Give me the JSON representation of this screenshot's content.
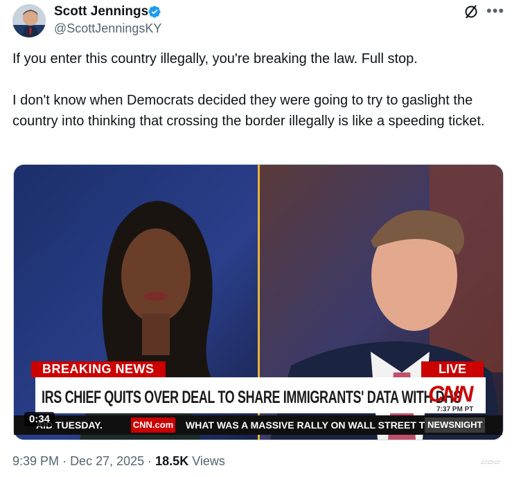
{
  "author": {
    "name": "Scott Jennings",
    "handle": "@ScottJenningsKY",
    "verified": true
  },
  "header_icons": {
    "grok": "grok-icon",
    "more": "more-icon"
  },
  "tweet": {
    "paragraphs": [
      "If you enter this country illegally, you're breaking the law. Full stop.",
      "I don't know when Democrats decided they were going to try to gaslight the country into thinking that crossing the border illegally is like a speeding ticket."
    ]
  },
  "video": {
    "duration": "0:34",
    "breaking_label": "BREAKING NEWS",
    "live_label": "LIVE",
    "headline": "IRS CHIEF QUITS OVER DEAL TO SHARE IMMIGRANTS' DATA WITH DHS",
    "network": "CNN",
    "time_stamp": "7:37 PM PT",
    "ticker_left": "AID TUESDAY.",
    "ticker_site": "CNN.com",
    "ticker_right": "WHAT WAS A MASSIVE RALLY ON WALL STREET TUR",
    "show_name": "NEWSNIGHT"
  },
  "meta": {
    "time": "9:39 PM",
    "date": "Dec 27, 2025",
    "views_count": "18.5K",
    "views_label": "Views"
  },
  "colors": {
    "accent_blue": "#1d9bf0",
    "cnn_red": "#cc0000",
    "muted_text": "#536471"
  }
}
